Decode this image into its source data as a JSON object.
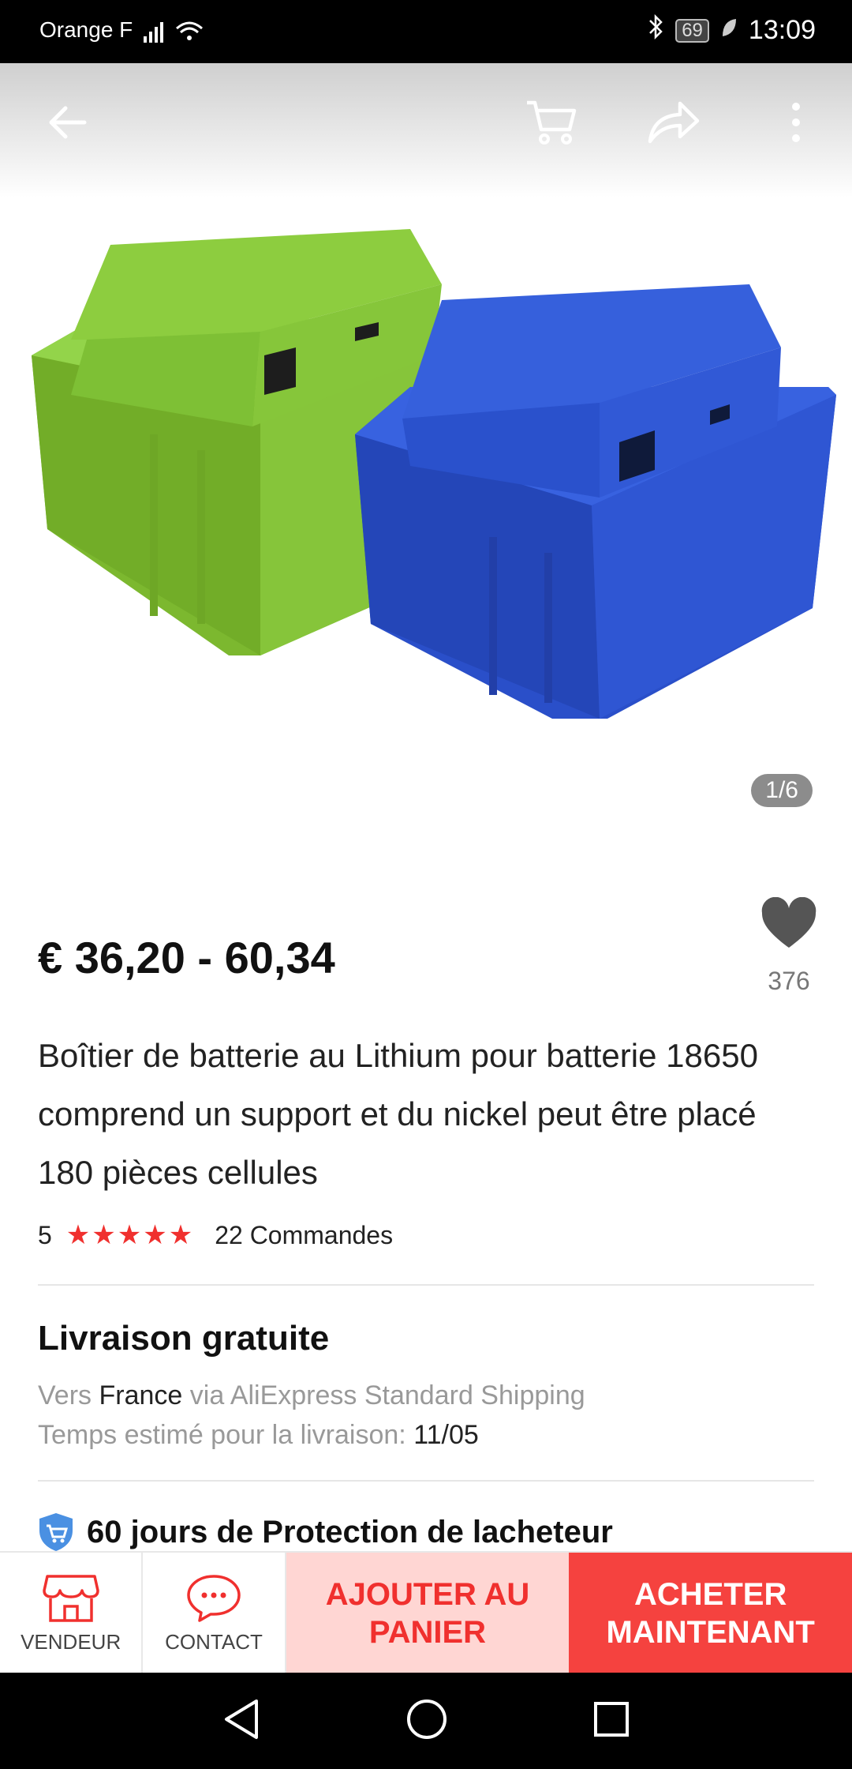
{
  "status_bar": {
    "carrier": "Orange F",
    "battery": "69",
    "time": "13:09"
  },
  "header": {
    "icons": [
      "back-arrow-icon",
      "cart-icon",
      "share-icon",
      "more-vert-icon"
    ]
  },
  "gallery": {
    "counter": "1/6",
    "colors": [
      "#8cc63f",
      "#2a4fc9"
    ]
  },
  "product": {
    "price": "€ 36,20 - 60,34",
    "likes": "376",
    "title": "Boîtier de batterie au Lithium pour batterie 18650 comprend un support et du nickel peut être placé 180 pièces cellules",
    "rating_value": "5",
    "rating_stars": "★★★★★",
    "orders": "22 Commandes"
  },
  "shipping": {
    "title": "Livraison gratuite",
    "to_label": "Vers",
    "country": "France",
    "via_text": "via AliExpress Standard Shipping",
    "eta_label": "Temps estimé pour la livraison:",
    "eta_value": "11/05"
  },
  "protection": {
    "text": "60 jours de Protection de lacheteur"
  },
  "actions": {
    "vendor_label": "VENDEUR",
    "contact_label": "CONTACT",
    "add_to_cart": "AJOUTER AU PANIER",
    "buy_now": "ACHETER MAINTENANT",
    "accent_color": "#f0302e"
  }
}
